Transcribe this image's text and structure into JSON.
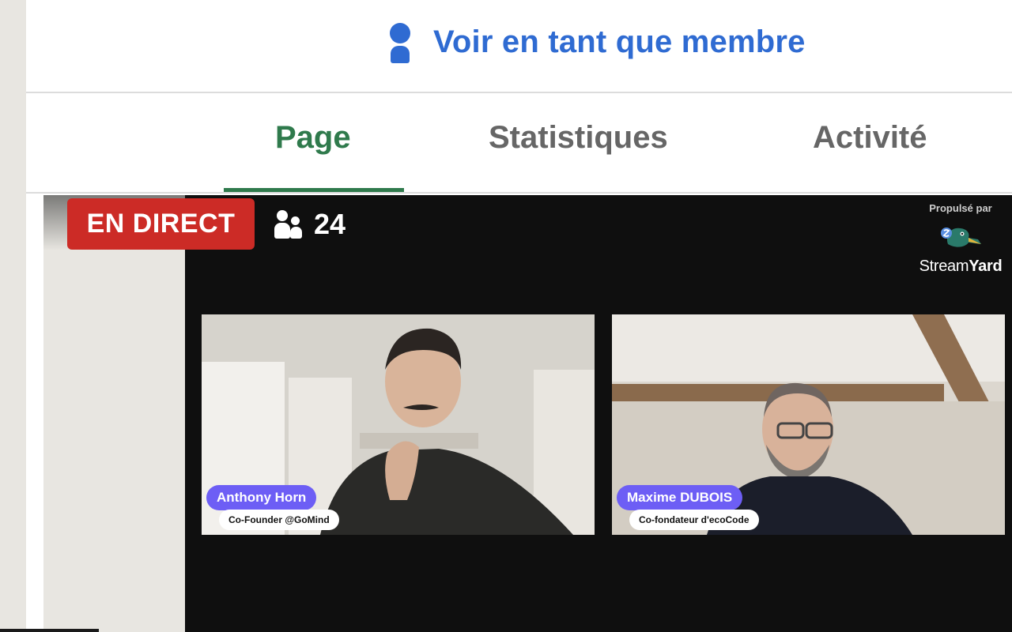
{
  "header": {
    "view_as_label": "Voir en tant que membre",
    "view_as_icon": "person-icon"
  },
  "tabs": [
    {
      "label": "Page",
      "active": true
    },
    {
      "label": "Statistiques",
      "active": false
    },
    {
      "label": "Activité",
      "active": false
    }
  ],
  "colors": {
    "accent_blue": "#2f6bd2",
    "active_tab_green": "#2f7a4c",
    "live_red": "#cc2b26",
    "name_tag_purple": "#6d5ef5"
  },
  "live": {
    "badge_label": "EN DIRECT",
    "viewers_icon": "people-icon",
    "viewer_count": "24",
    "powered_by_label": "Propulsé par",
    "brand_prefix": "Stream",
    "brand_suffix": "Yard"
  },
  "participants": [
    {
      "name": "Anthony Horn",
      "role": "Co-Founder @GoMind"
    },
    {
      "name": "Maxime DUBOIS",
      "role": "Co-fondateur d'ecoCode"
    }
  ]
}
